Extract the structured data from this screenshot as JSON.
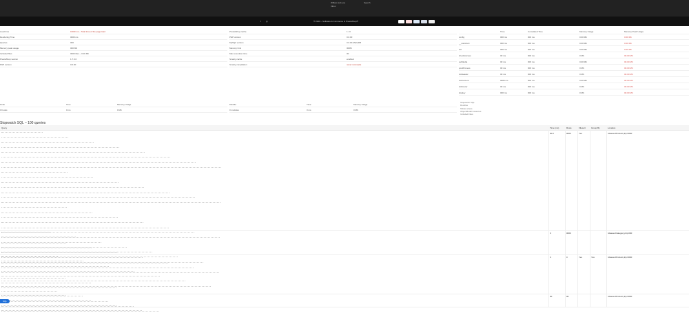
{
  "header": {
    "lines": [
      "Wiffam Hub ess",
      "Inbox"
    ],
    "right_text": "Search"
  },
  "footer": {
    "copyright": "© 2023 – Software & Commerce & PrestaShop®",
    "social": [
      "f",
      "◎"
    ],
    "payments": [
      {
        "name": "visa-icon",
        "color": "#1a1f71"
      },
      {
        "name": "mastercard-icon",
        "color": "#eb001b"
      },
      {
        "name": "amex-icon",
        "color": "#2e77bc"
      },
      {
        "name": "paypal-icon",
        "color": "#003087"
      },
      {
        "name": "card-icon",
        "color": "#777777"
      }
    ]
  },
  "stats_left": [
    {
      "label": "Load time",
      "value": "0.000 ms – Total time of the page load"
    },
    {
      "label": "Rendering Time",
      "value": "0000 ms"
    },
    {
      "label": "Queries",
      "value": "000"
    },
    {
      "label": "Memory peak usage",
      "value": "000 Mb"
    },
    {
      "label": "Included files",
      "value": "0000 files – 0.00 Mb"
    },
    {
      "label": "PrestaShop version",
      "value": "1.7.0.0"
    },
    {
      "label": "PHP version",
      "value": "0.0.00"
    }
  ],
  "stats_mid": [
    {
      "label": "PrestaShop cache",
      "value": "1 / 0"
    },
    {
      "label": "PHP version",
      "value": "0.0.00"
    },
    {
      "label": "MySQL version",
      "value": "0.0.00-MariaDB"
    },
    {
      "label": "Memory limit",
      "value": "000M"
    },
    {
      "label": "Max execution time",
      "value": "00"
    },
    {
      "label": "Smarty cache",
      "value": "enabled"
    },
    {
      "label": "Smarty compilation",
      "value": "never recompile"
    }
  ],
  "stats_right": {
    "headers": [
      "",
      "Time",
      "Cumulated Time",
      "Memory Usage",
      "Memory Peak Usage"
    ],
    "rows": [
      [
        "config",
        "000 ms",
        "000 ms",
        "0.00 Mb",
        "0.00 Mb"
      ],
      [
        "__construct",
        "000 ms",
        "000 ms",
        "0.00 Mb",
        "0.00 Mb"
      ],
      [
        "init",
        "000 ms",
        "000 ms",
        "0.00 Mb",
        "0.00 Mb"
      ],
      [
        "checkAccess",
        "00 ms",
        "000 ms",
        "0 Mb",
        "00.00 Mb"
      ],
      [
        "setMedia",
        "00 ms",
        "000 ms",
        "0.00 Mb",
        "00.00 Mb"
      ],
      [
        "postProcess",
        "00 ms",
        "000 ms",
        "0 Mb",
        "00.00 Mb"
      ],
      [
        "initHeader",
        "00 ms",
        "000 ms",
        "0 Mb",
        "00.00 Mb"
      ],
      [
        "initContent",
        "0000 ms",
        "000 ms",
        "0.00 Mb",
        "00.00 Mb"
      ],
      [
        "initFooter",
        "00 ms",
        "000 ms",
        "0 Mb",
        "00.00 Mb"
      ],
      [
        "display",
        "000 ms",
        "000 ms",
        "0 Mb",
        "00.00 Mb"
      ]
    ]
  },
  "hooks_table": {
    "left_headers": [
      "Hook",
      "Time",
      "Memory Usage"
    ],
    "left_row": [
      "0 hooks",
      "0 ms",
      "0 Mb"
    ],
    "mid_headers": [
      "Module",
      "Time",
      "Memory Usage"
    ],
    "mid_row": [
      "0 modules",
      "0 ms",
      "0 Mb"
    ]
  },
  "legend": [
    "Stopwatch SQL",
    "Doubles",
    "Tables stress",
    "ObjectModel instances",
    "Included Files"
  ],
  "queries_title": "Stopwatch SQL – 100 queries",
  "queries_headers": [
    "Query",
    "Time (ms)",
    "Rows",
    "Filesort",
    "Group By",
    "Location"
  ],
  "queries": [
    {
      "time": "00.0",
      "rows": "0000",
      "filesort": "Yes",
      "group": "",
      "location": "/classes/Product.php:0000"
    },
    {
      "time": "0",
      "rows": "0000",
      "filesort": "",
      "group": "",
      "location": "/classes/Category.php:000"
    },
    {
      "time": "0",
      "rows": "0",
      "filesort": "Yes",
      "group": "Yes",
      "location": "/classes/Product.php:0000"
    },
    {
      "time": "00",
      "rows": "00",
      "filesort": "",
      "group": "",
      "location": "/classes/Product.php:0000"
    }
  ],
  "badge": "SQL"
}
